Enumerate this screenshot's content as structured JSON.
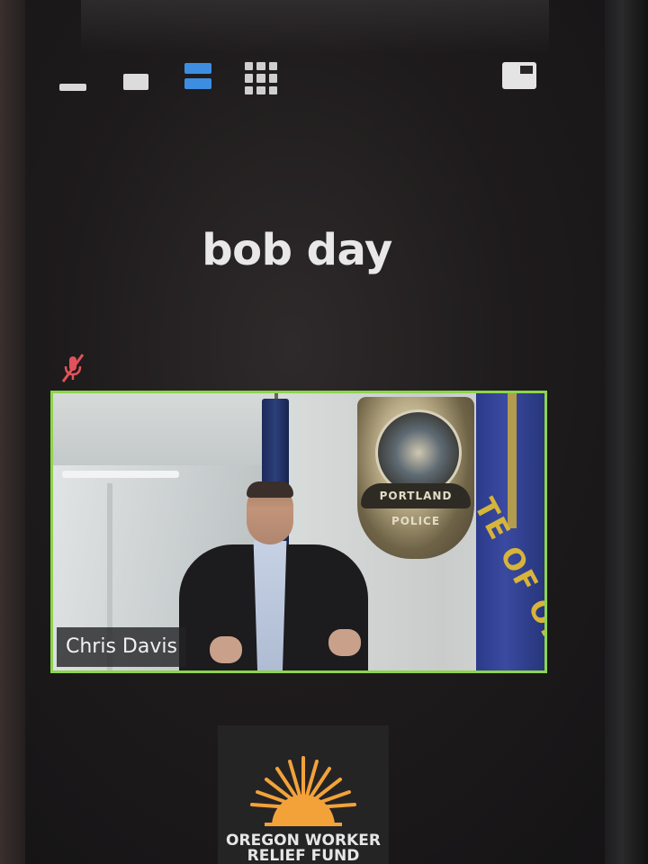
{
  "toolbar": {
    "icons": [
      "minimize-icon",
      "speaker-view-icon",
      "stacked-view-icon",
      "gallery-view-icon",
      "floating-window-icon"
    ],
    "active_color": "#3d8ee0"
  },
  "active_speaker": {
    "name": "bob day",
    "muted": true,
    "mute_icon_color": "#e0535b"
  },
  "video_tile": {
    "participant_name": "Chris Davis",
    "border_color": "#8dd44d",
    "badge_text": "PORTLAND POLICE",
    "flag_text": "TE OF OR"
  },
  "logo_tile": {
    "line1": "OREGON WORKER",
    "line2": "RELIEF FUND",
    "sun_color": "#f3a23a"
  }
}
